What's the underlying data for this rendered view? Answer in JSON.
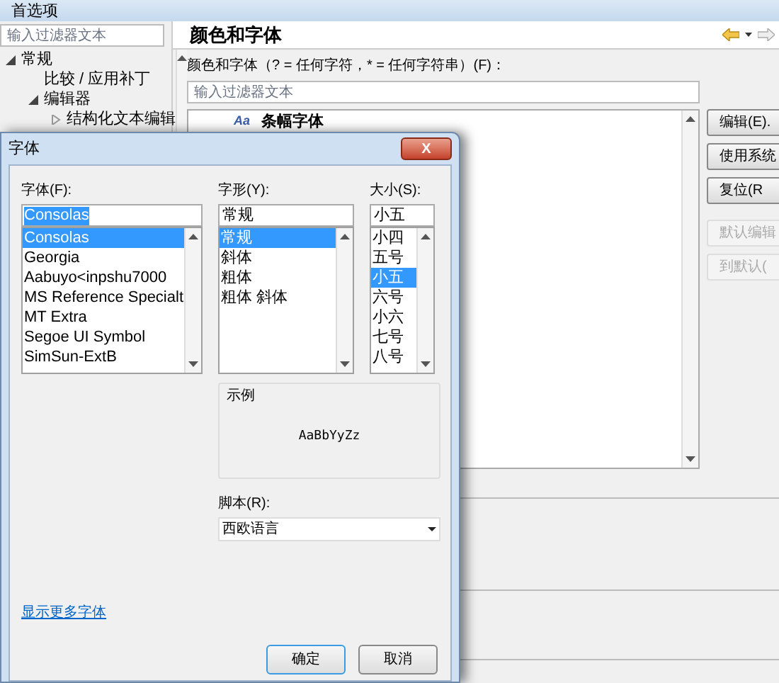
{
  "window": {
    "title": "首选项"
  },
  "sidebar": {
    "filter": {
      "placeholder": "输入过滤器文本"
    },
    "tree": [
      {
        "label": "常规",
        "expanded": true,
        "children": [
          {
            "label": "比较 / 应用补丁"
          },
          {
            "label": "编辑器",
            "expanded": true,
            "children": [
              {
                "label": "结构化文本编辑",
                "expanded": false
              }
            ]
          }
        ]
      }
    ]
  },
  "page": {
    "title": "颜色和字体",
    "filter_label": "颜色和字体（? = 任何字符，* = 任何字符串）(F)：",
    "filter": {
      "placeholder": "输入过滤器文本"
    },
    "list_items": [
      {
        "label": "条幅字体",
        "icon": "Aa"
      }
    ],
    "buttons": [
      {
        "label": "编辑(E).",
        "disabled": false
      },
      {
        "label": "使用系统",
        "disabled": false
      },
      {
        "label": "复位(R",
        "disabled": false
      },
      {
        "label": "默认编辑",
        "disabled": true
      },
      {
        "label": "到默认(",
        "disabled": true
      }
    ]
  },
  "dialog": {
    "title": "字体",
    "close": "X",
    "font": {
      "label": "字体(F):",
      "value": "Consolas",
      "options": [
        {
          "label": "Consolas",
          "selected": true
        },
        {
          "label": "Georgia",
          "selected": false
        },
        {
          "label": "Aabuyo<inpshu7000",
          "selected": false
        },
        {
          "label": "MS Reference Specialt",
          "selected": false
        },
        {
          "label": "MT Extra",
          "selected": false
        },
        {
          "label": "Segoe UI Symbol",
          "selected": false
        },
        {
          "label": "SimSun-ExtB",
          "selected": false
        }
      ]
    },
    "style": {
      "label": "字形(Y):",
      "value": "常规",
      "options": [
        {
          "label": "常规",
          "selected": true
        },
        {
          "label": "斜体",
          "selected": false
        },
        {
          "label": "粗体",
          "selected": false
        },
        {
          "label": "粗体 斜体",
          "selected": false
        }
      ]
    },
    "size": {
      "label": "大小(S):",
      "value": "小五",
      "options": [
        {
          "label": "小四",
          "selected": false
        },
        {
          "label": "五号",
          "selected": false
        },
        {
          "label": "小五",
          "selected": true
        },
        {
          "label": "六号",
          "selected": false
        },
        {
          "label": "小六",
          "selected": false
        },
        {
          "label": "七号",
          "selected": false
        },
        {
          "label": "八号",
          "selected": false
        }
      ]
    },
    "sample": {
      "label": "示例",
      "text": "AaBbYyZz"
    },
    "script": {
      "label": "脚本(R):",
      "value": "西欧语言"
    },
    "more_fonts_link": "显示更多字体",
    "buttons": [
      {
        "label": "确定",
        "default": true
      },
      {
        "label": "取消",
        "default": false
      }
    ]
  }
}
